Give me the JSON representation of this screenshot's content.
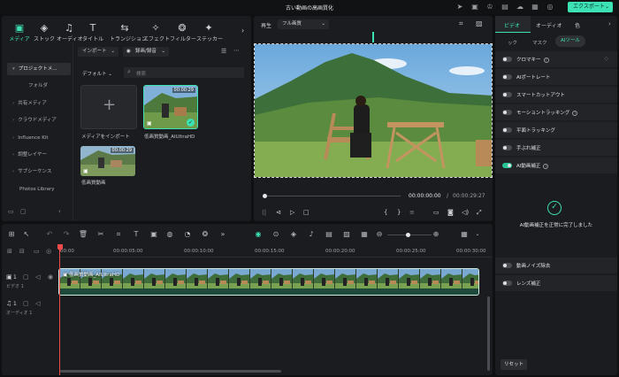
{
  "app": {
    "title": "古い動画の高画質化",
    "export_label": "エクスポート"
  },
  "media_tabs": [
    {
      "label": "メディア",
      "icon": "media-icon",
      "active": true
    },
    {
      "label": "ストック",
      "icon": "stock-icon"
    },
    {
      "label": "オーディオ",
      "icon": "audio-icon"
    },
    {
      "label": "タイトル",
      "icon": "title-icon"
    },
    {
      "label": "トランジション",
      "icon": "transition-icon"
    },
    {
      "label": "エフェクト",
      "icon": "effect-icon"
    },
    {
      "label": "フィルター",
      "icon": "filter-icon"
    },
    {
      "label": "ステッカー",
      "icon": "sticker-icon"
    }
  ],
  "sidebar": {
    "items": [
      {
        "label": "プロジェクトメ...",
        "selected": true
      },
      {
        "label": "フォルダ"
      },
      {
        "label": "共有メディア"
      },
      {
        "label": "クラウドメディア"
      },
      {
        "label": "Influence Kit"
      },
      {
        "label": "調整レイヤー"
      },
      {
        "label": "サブシーケンス"
      },
      {
        "label": "Photos Library"
      }
    ]
  },
  "media_toolbar": {
    "import_label": "インポート",
    "record_label": "録画/録音",
    "default_label": "デフォルト",
    "search_placeholder": "検索"
  },
  "media_items": [
    {
      "label": "メディアをインポート"
    },
    {
      "label": "低画質動画_AIUltraHD",
      "duration": "00:00:29"
    },
    {
      "label": "低画質動画",
      "duration": "00:00:29"
    }
  ],
  "preview": {
    "label": "再生",
    "quality": "フル画質",
    "current_time": "00:00:00:00",
    "separator": "/",
    "total_time": "00:00:29:27"
  },
  "props": {
    "tabs": [
      "ビデオ",
      "オーディオ",
      "色"
    ],
    "subtabs": [
      "ック",
      "マスク",
      "AIツール"
    ],
    "tools": [
      {
        "label": "クロマキー",
        "on": false,
        "help": true
      },
      {
        "label": "AIポートレート",
        "on": false
      },
      {
        "label": "スマートカットアウト",
        "on": false
      },
      {
        "label": "モーショントラッキング",
        "on": false,
        "help": true
      },
      {
        "label": "平面トラッキング",
        "on": false
      },
      {
        "label": "手ぶれ補正",
        "on": false
      },
      {
        "label": "AI動画補正",
        "on": true,
        "help": true
      }
    ],
    "success_message": "AI動画補正を正常に完了しました",
    "tools2": [
      {
        "label": "動画ノイズ除去",
        "on": false
      },
      {
        "label": "レンズ補正",
        "on": false
      }
    ],
    "reset_label": "リセット",
    "accent": "#3ce1b4"
  },
  "timeline": {
    "ruler": [
      "00:00",
      "00:00:05:00",
      "00:00:10:00",
      "00:00:15:00",
      "00:00:20:00",
      "00:00:25:00",
      "00:00:30:00"
    ],
    "tracks": [
      {
        "icon_label": "1",
        "name": "ビデオ 1"
      },
      {
        "icon_label": "1",
        "name": "オーディオ 1"
      }
    ],
    "clip_label": "低画質動画_AIUltraHD"
  }
}
